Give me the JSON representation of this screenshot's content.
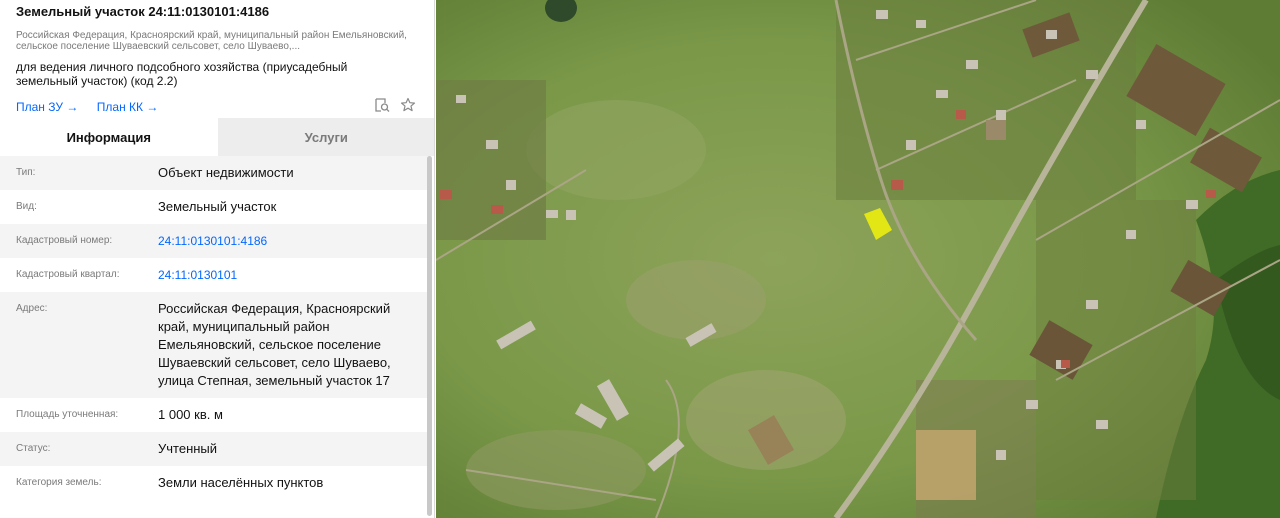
{
  "header": {
    "title": "Земельный участок 24:11:0130101:4186",
    "address_short": "Российская Федерация, Красноярский край, муниципальный район Емельяновский, сельское поселение Шуваевский сельсовет, село Шуваево,...",
    "purpose": "для ведения личного подсобного хозяйства (приусадебный земельный участок) (код 2.2)",
    "link_plan_zu": "План ЗУ →",
    "link_plan_kk": "План КК →",
    "icons": [
      "search-document-icon",
      "star-icon"
    ]
  },
  "tabs": [
    {
      "label": "Информация",
      "active": true
    },
    {
      "label": "Услуги",
      "active": false
    }
  ],
  "rows": [
    {
      "label": "Тип:",
      "value": "Объект недвижимости"
    },
    {
      "label": "Вид:",
      "value": "Земельный участок"
    },
    {
      "label": "Кадастровый номер:",
      "value": "24:11:0130101:4186",
      "link": true
    },
    {
      "label": "Кадастровый квартал:",
      "value": "24:11:0130101",
      "link": true
    },
    {
      "label": "Адрес:",
      "value": "Российская Федерация, Красноярский край, муниципальный район Емельяновский, сельское поселение Шуваевский сельсовет, село Шуваево, улица Степная, земельный участок 17"
    },
    {
      "label": "Площадь уточненная:",
      "value": "1 000 кв. м"
    },
    {
      "label": "Статус:",
      "value": "Учтенный"
    },
    {
      "label": "Категория земель:",
      "value": "Земли населённых пунктов"
    }
  ],
  "colors": {
    "link": "#0468ff",
    "parcel_highlight": "#f2f20a",
    "map_grass": "#7a9a4a"
  }
}
